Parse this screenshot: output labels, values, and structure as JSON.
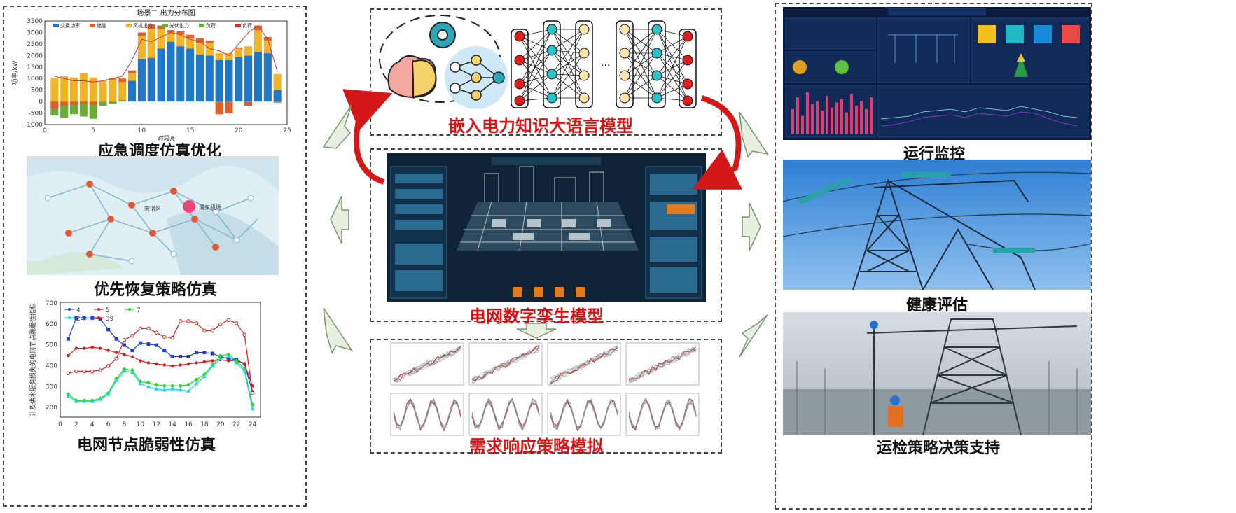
{
  "left": {
    "captions": {
      "emergency": "应急调度仿真优化",
      "restoration": "优先恢复策略仿真",
      "vulnerability": "电网节点脆弱性仿真"
    },
    "map_labels": [
      "宋消区",
      "浦东机场"
    ]
  },
  "center": {
    "llm": "嵌入电力知识大语言模型",
    "twin": "电网数字孪生模型",
    "demand": "需求响应策略模拟",
    "nn_ellipsis": "···"
  },
  "right": {
    "monitor": "运行监控",
    "health": "健康评估",
    "maintenance": "运检策略决策支持"
  },
  "chart_data": [
    {
      "type": "bar",
      "title": "场景二  出力分布图",
      "xlabel": "时段/t",
      "ylabel": "功率/kW",
      "ylim": [
        -1000,
        3500
      ],
      "xlim": [
        0,
        25
      ],
      "legend": [
        "交换功率",
        "储能",
        "风机出力",
        "光伏出力",
        "负荷",
        "负荷"
      ],
      "x_ticks": [
        "0",
        "5",
        "10",
        "15",
        "20",
        "25"
      ],
      "y_ticks": [
        "-1000",
        "-500",
        "0",
        "500",
        "1000",
        "1500",
        "2000",
        "2500",
        "3000",
        "3500"
      ],
      "x": [
        1,
        2,
        3,
        4,
        5,
        6,
        7,
        8,
        9,
        10,
        11,
        12,
        13,
        14,
        15,
        16,
        17,
        18,
        19,
        20,
        21,
        22,
        23,
        24
      ],
      "series": [
        {
          "name": "交换功率",
          "color": "#1f77c8",
          "values": [
            0,
            0,
            0,
            0,
            0,
            0,
            0,
            50,
            900,
            1850,
            1900,
            2300,
            2600,
            2400,
            2300,
            2050,
            2000,
            1800,
            1800,
            1950,
            2000,
            2150,
            2100,
            500
          ]
        },
        {
          "name": "风机出力",
          "color": "#f0b428",
          "values": [
            1000,
            1100,
            1050,
            1250,
            1050,
            900,
            950,
            800,
            350,
            1000,
            1250,
            850,
            400,
            500,
            450,
            500,
            550,
            300,
            300,
            350,
            400,
            950,
            550,
            700
          ]
        },
        {
          "name": "储能",
          "color": "#e0602a",
          "values": [
            -300,
            -200,
            -150,
            -100,
            -150,
            0,
            50,
            150,
            100,
            150,
            200,
            150,
            100,
            150,
            150,
            200,
            100,
            -550,
            -500,
            50,
            -200,
            200,
            150,
            -50
          ]
        },
        {
          "name": "光伏出力",
          "color": "#6aac3a",
          "values": [
            -300,
            -500,
            -400,
            -550,
            -600,
            -200,
            -100,
            0,
            0,
            0,
            0,
            0,
            0,
            0,
            0,
            0,
            0,
            0,
            0,
            0,
            0,
            0,
            0,
            0
          ]
        },
        {
          "name": "负荷",
          "color": "#c33",
          "line": [
            1100,
            1000,
            900,
            900,
            850,
            900,
            1000,
            1100,
            1800,
            2700,
            2600,
            2800,
            3000,
            2900,
            2700,
            2600,
            2300,
            2200,
            2000,
            2500,
            3000,
            3300,
            2700,
            1300
          ]
        }
      ]
    },
    {
      "type": "line",
      "xlabel": "",
      "ylabel": "计及供水服务损失的电网节点脆弱性指标",
      "ylim": [
        150,
        700
      ],
      "xlim": [
        0,
        25
      ],
      "x_ticks": [
        "0",
        "2",
        "4",
        "6",
        "8",
        "10",
        "12",
        "14",
        "16",
        "18",
        "20",
        "22",
        "24"
      ],
      "y_ticks": [
        "200",
        "300",
        "400",
        "500",
        "600",
        "700"
      ],
      "x": [
        1,
        2,
        3,
        4,
        5,
        6,
        7,
        8,
        9,
        10,
        11,
        12,
        13,
        14,
        15,
        16,
        17,
        18,
        19,
        20,
        21,
        22,
        23,
        24
      ],
      "series": [
        {
          "name": "4",
          "color": "#1a3fd6",
          "marker": "square",
          "values": [
            525,
            625,
            625,
            625,
            620,
            570,
            525,
            495,
            470,
            505,
            500,
            495,
            470,
            440,
            440,
            440,
            460,
            460,
            455,
            440,
            430,
            425,
            405,
            270
          ]
        },
        {
          "name": "5",
          "color": "#e01818",
          "marker": "circle",
          "values": [
            445,
            480,
            480,
            485,
            480,
            470,
            460,
            450,
            440,
            420,
            410,
            405,
            400,
            395,
            400,
            405,
            410,
            415,
            420,
            425,
            420,
            420,
            405,
            300
          ]
        },
        {
          "name": "7",
          "color": "#18e018",
          "marker": "diamond",
          "values": [
            260,
            230,
            230,
            230,
            240,
            265,
            335,
            380,
            375,
            320,
            315,
            305,
            300,
            300,
            300,
            305,
            330,
            355,
            400,
            445,
            450,
            420,
            380,
            210
          ]
        },
        {
          "name": "24",
          "color": "#18d0e8",
          "marker": "triangle",
          "values": [
            250,
            225,
            225,
            225,
            235,
            260,
            325,
            370,
            365,
            310,
            295,
            285,
            280,
            285,
            280,
            275,
            310,
            345,
            395,
            430,
            440,
            410,
            370,
            190
          ]
        },
        {
          "name": "39",
          "color": "#e01818",
          "marker": "circle-open",
          "values": [
            360,
            370,
            370,
            370,
            375,
            395,
            430,
            520,
            540,
            575,
            575,
            555,
            535,
            530,
            610,
            610,
            600,
            565,
            565,
            595,
            615,
            600,
            545,
            265
          ]
        }
      ]
    }
  ]
}
